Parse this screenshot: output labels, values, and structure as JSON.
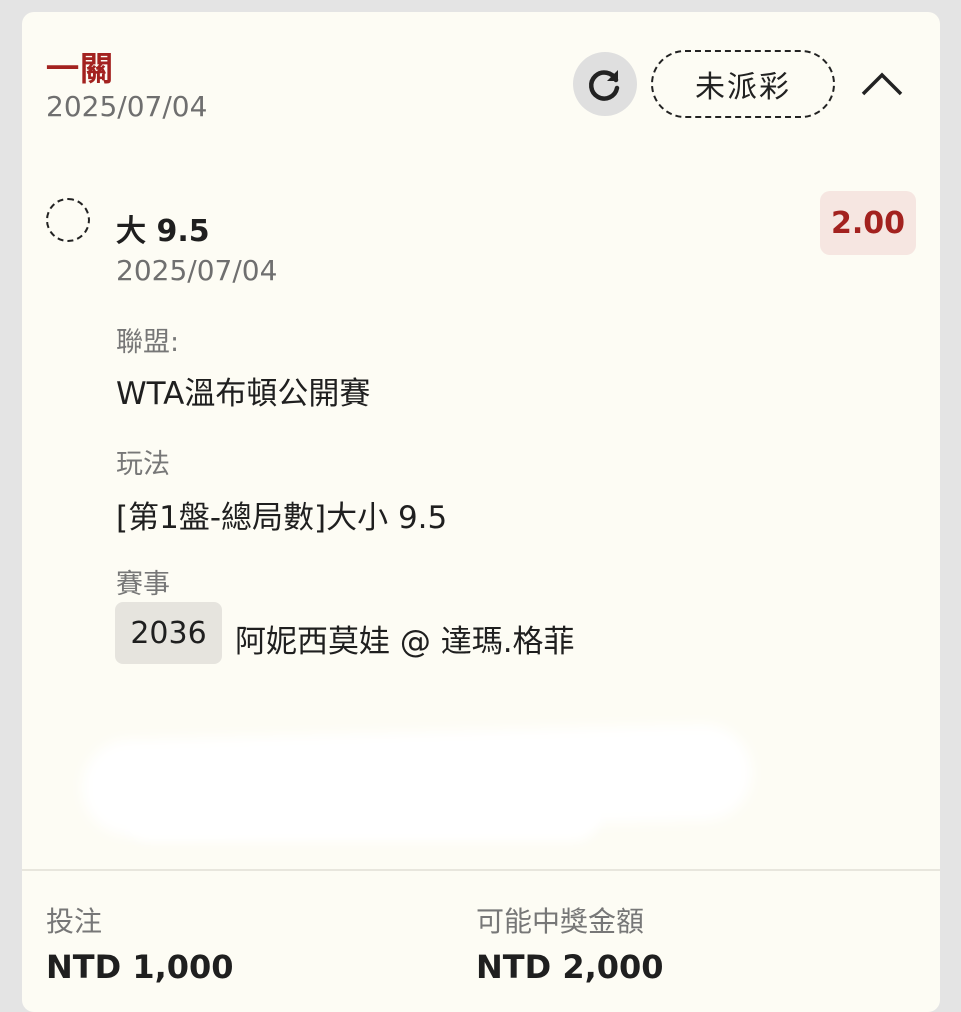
{
  "header": {
    "bet_type": "一關",
    "date": "2025/07/04",
    "status": "未派彩"
  },
  "selection": {
    "name": "大 9.5",
    "date": "2025/07/04",
    "odds": "2.00"
  },
  "details": {
    "league_label": "聯盟:",
    "league_value": "WTA溫布頓公開賽",
    "market_label": "玩法",
    "market_value": "[第1盤-總局數]大小 9.5",
    "event_label": "賽事",
    "event_id": "2036",
    "event_match": "阿妮西莫娃 @ 達瑪.格菲"
  },
  "footer": {
    "stake_label": "投注",
    "stake_value": "NTD 1,000",
    "payout_label": "可能中獎金額",
    "payout_value": "NTD 2,000"
  },
  "icons": {
    "refresh": "refresh-icon",
    "collapse": "chevron-up-icon"
  },
  "colors": {
    "accent": "#a3221f",
    "card_background": "#fdfcf4",
    "odds_background": "#f6e6e1"
  }
}
